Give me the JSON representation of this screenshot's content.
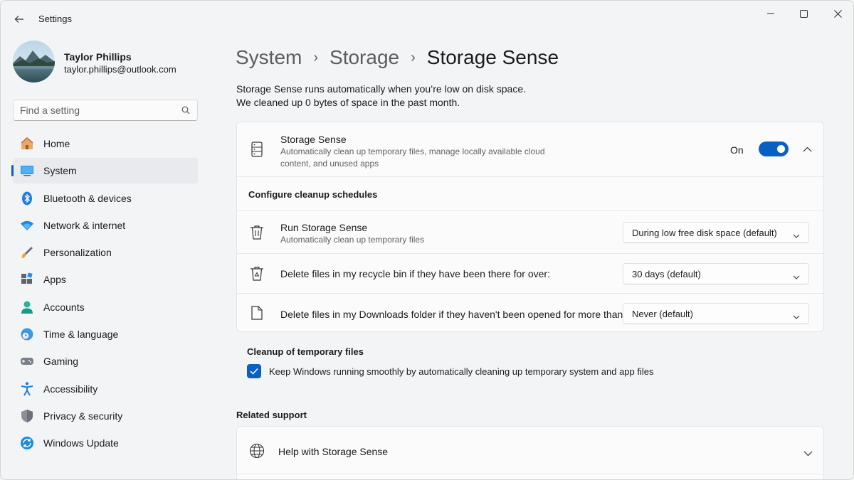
{
  "app": {
    "title": "Settings"
  },
  "profile": {
    "name": "Taylor Phillips",
    "email": "taylor.phillips@outlook.com"
  },
  "search": {
    "placeholder": "Find a setting"
  },
  "sidebar": {
    "items": [
      {
        "label": "Home",
        "icon": "home-icon"
      },
      {
        "label": "System",
        "icon": "system-icon",
        "active": true
      },
      {
        "label": "Bluetooth & devices",
        "icon": "bluetooth-icon"
      },
      {
        "label": "Network & internet",
        "icon": "wifi-icon"
      },
      {
        "label": "Personalization",
        "icon": "brush-icon"
      },
      {
        "label": "Apps",
        "icon": "apps-icon"
      },
      {
        "label": "Accounts",
        "icon": "account-icon"
      },
      {
        "label": "Time & language",
        "icon": "globe-clock-icon"
      },
      {
        "label": "Gaming",
        "icon": "gamepad-icon"
      },
      {
        "label": "Accessibility",
        "icon": "accessibility-icon"
      },
      {
        "label": "Privacy & security",
        "icon": "shield-icon"
      },
      {
        "label": "Windows Update",
        "icon": "update-icon"
      }
    ]
  },
  "breadcrumb": [
    "System",
    "Storage",
    "Storage Sense"
  ],
  "description": {
    "line1": "Storage Sense runs automatically when you’re low on disk space.",
    "line2": "We cleaned up 0 bytes of space in the past month."
  },
  "storage_sense": {
    "title": "Storage Sense",
    "subtitle_line1": "Automatically clean up temporary files, manage locally available cloud",
    "subtitle_line2": "content, and unused apps",
    "toggle_label": "On",
    "toggle_on": true
  },
  "schedules": {
    "heading": "Configure cleanup schedules",
    "run": {
      "title": "Run Storage Sense",
      "subtitle": "Automatically clean up temporary files",
      "value": "During low free disk space (default)"
    },
    "recycle": {
      "title": "Delete files in my recycle bin if they have been there for over:",
      "value": "30 days (default)"
    },
    "downloads": {
      "title": "Delete files in my Downloads folder if they haven't been opened for more than:",
      "value": "Never (default)"
    }
  },
  "temp_files": {
    "heading": "Cleanup of temporary files",
    "checkbox_label": "Keep Windows running smoothly by automatically cleaning up temporary system and app files",
    "checked": true
  },
  "related": {
    "heading": "Related support",
    "help_label": "Help with Storage Sense"
  },
  "colors": {
    "accent": "#0a5fc2",
    "window_bg": "#f3f4f6",
    "card_bg": "#fbfbfb"
  }
}
